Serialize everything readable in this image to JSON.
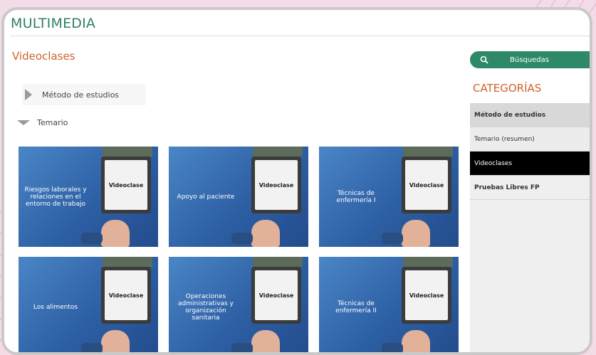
{
  "page": {
    "title": "MULTIMEDIA"
  },
  "main": {
    "section_title": "Videoclases",
    "accordion": [
      {
        "label": "Método de estudios",
        "expanded": false
      },
      {
        "label": "Temario",
        "expanded": true
      }
    ],
    "cards": [
      {
        "label": "Riesgos laborales y relaciones en el entorno de trabajo",
        "badge": "Videoclase"
      },
      {
        "label": "Apoyo al paciente",
        "badge": "Videoclase"
      },
      {
        "label": "Técnicas de enfermería I",
        "badge": "Videoclase"
      },
      {
        "label": "Los alimentos",
        "badge": "Videoclase"
      },
      {
        "label": "Operaciones administrativas y organización sanitaria",
        "badge": "Videoclase"
      },
      {
        "label": "Técnicas de enfermería II",
        "badge": "Videoclase"
      }
    ]
  },
  "sidebar": {
    "search_label": "Búsquedas",
    "categories_title": "CATEGORÍAS",
    "categories": [
      {
        "label": "Método de estudios"
      },
      {
        "label": "Temario (resumen)"
      },
      {
        "label": "Videoclases"
      },
      {
        "label": "Pruebas Libres FP"
      }
    ]
  },
  "colors": {
    "brand_green": "#2e7f63",
    "accent_orange": "#d0632a",
    "card_blue": "#2d5fa4",
    "active_item": "#000000"
  }
}
